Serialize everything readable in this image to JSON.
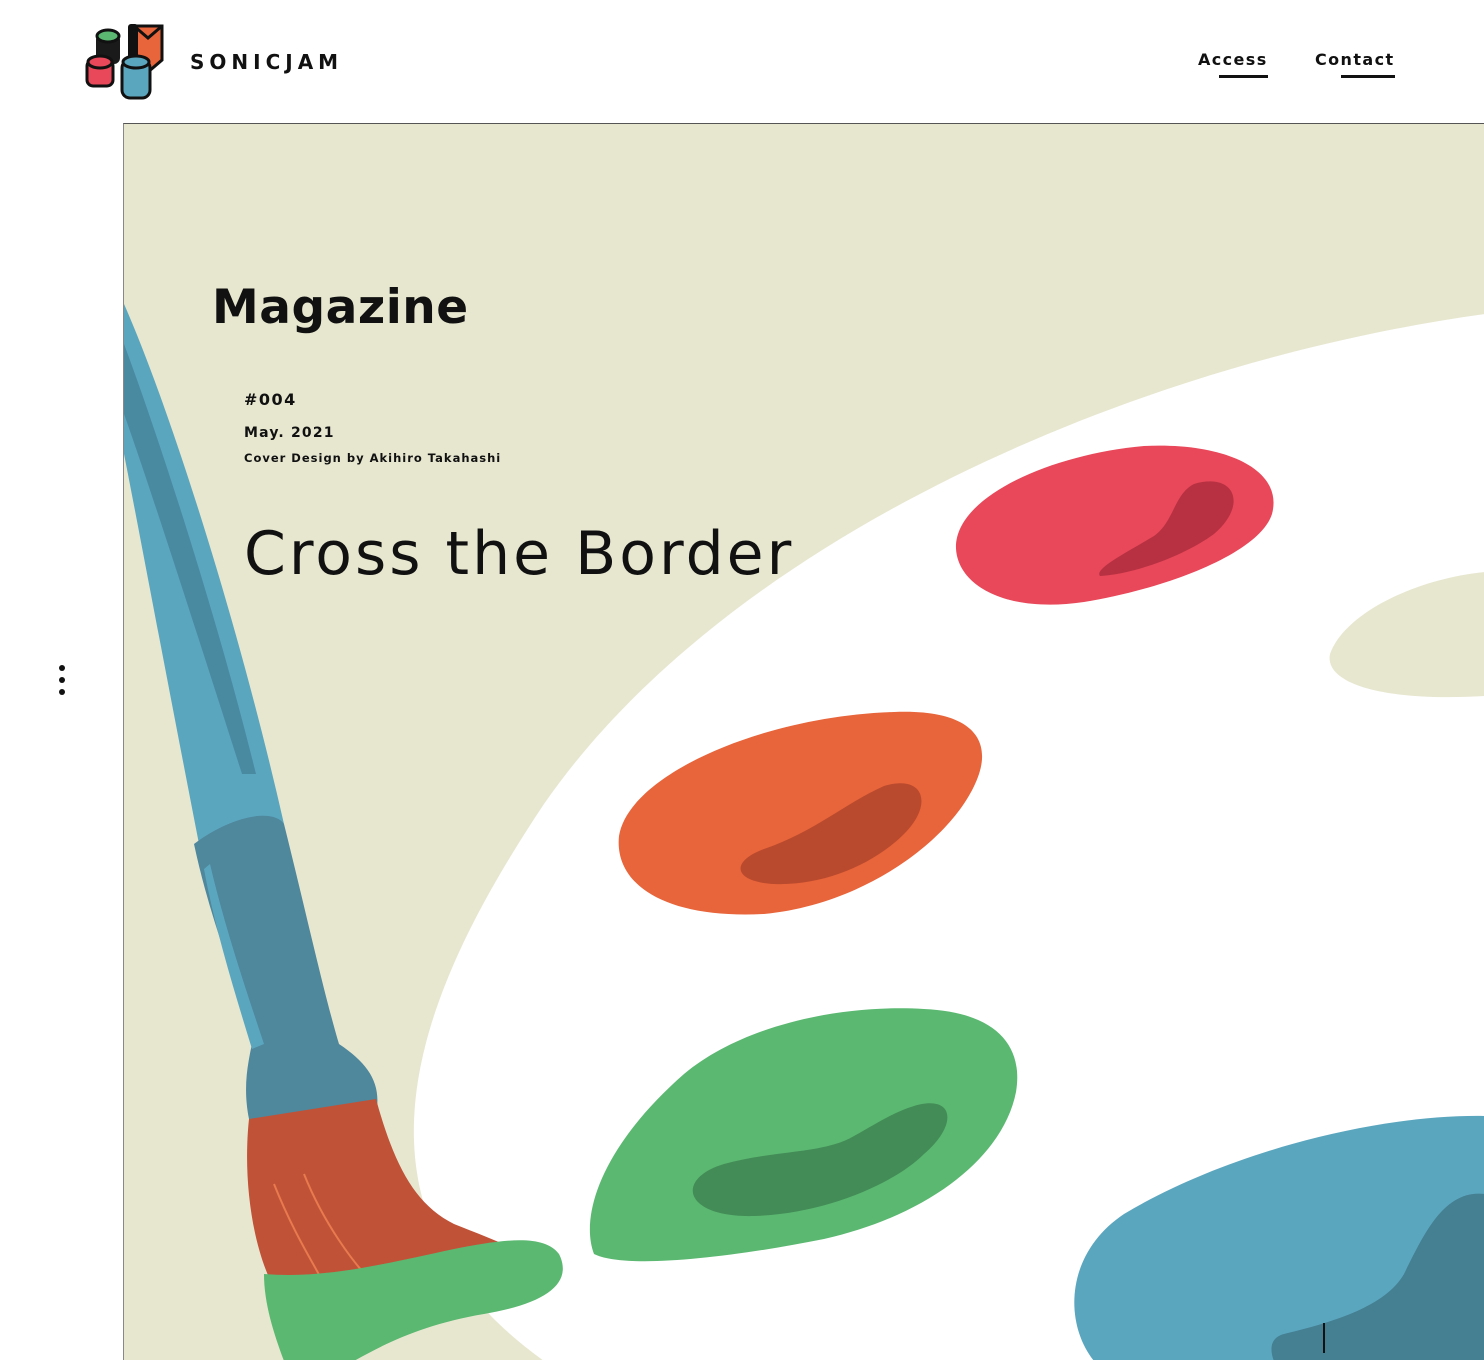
{
  "header": {
    "brand_name": "SONICJAM",
    "nav": [
      {
        "label": "Access"
      },
      {
        "label": "Contact"
      }
    ]
  },
  "hero": {
    "section_title": "Magazine",
    "issue_number": "#004",
    "issue_date": "May. 2021",
    "cover_credit": "Cover Design by Akihiro Takahashi",
    "headline": "Cross the Border"
  },
  "colors": {
    "background": "#ffffff",
    "hero_background": "#e7e7d0",
    "palette_board": "#ffffff",
    "paint_red": "#e84859",
    "paint_orange": "#e8643a",
    "paint_green": "#5bb871",
    "paint_blue": "#5ba6bf",
    "brush_bristles": "#c05238",
    "text": "#111111"
  },
  "icons": {
    "logo": "sonicjam-logo-icon",
    "menu": "vertical-dots-menu-icon"
  }
}
